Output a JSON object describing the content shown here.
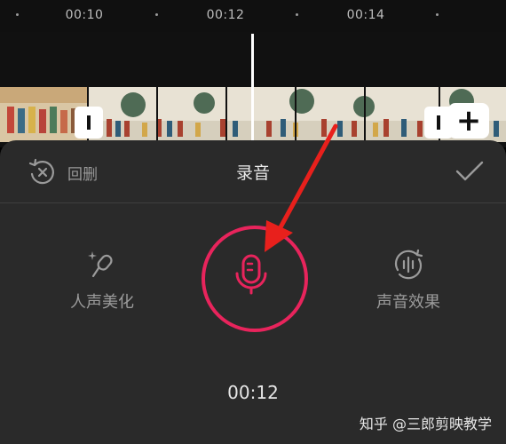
{
  "ruler": {
    "ticks": [
      "00:10",
      "00:12",
      "00:14"
    ]
  },
  "toolbar": {
    "undo_label": "回删",
    "title": "录音"
  },
  "tools": {
    "voice_beautify": "人声美化",
    "sound_effects": "声音效果"
  },
  "recording": {
    "time": "00:12"
  },
  "watermark": "知乎 @三郎剪映教学",
  "colors": {
    "accent": "#e8245c",
    "arrow": "#e8201c",
    "panel": "#2a2a2a"
  },
  "icons": {
    "undo": "undo-circle-icon",
    "confirm": "checkmark-icon",
    "voice_beautify": "magic-mic-icon",
    "sound_effects": "sound-wave-icon",
    "record": "microphone-icon",
    "add": "plus-icon"
  }
}
